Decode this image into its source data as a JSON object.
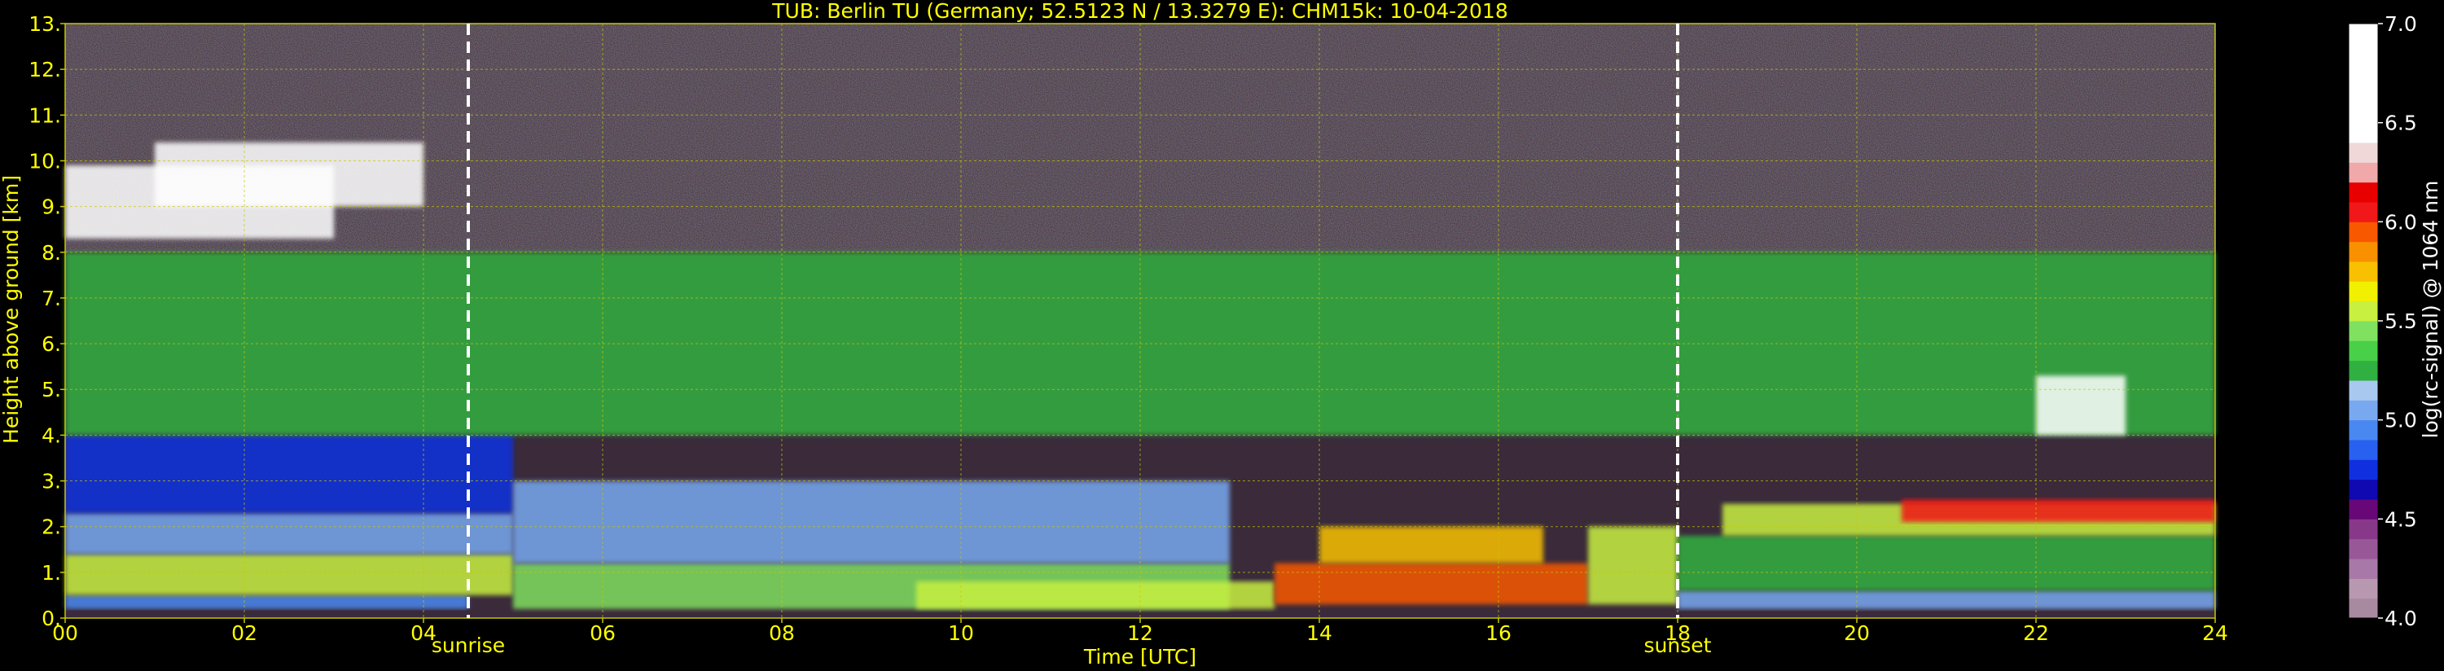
{
  "chart_data": {
    "type": "heatmap",
    "title": "TUB: Berlin TU (Germany; 52.5123 N / 13.3279 E):    CHM15k: 10-04-2018",
    "xlabel": "Time [UTC]",
    "ylabel": "Height above ground [km]",
    "xlim": [
      0,
      24
    ],
    "ylim": [
      0,
      13
    ],
    "x_ticks": [
      0,
      2,
      4,
      6,
      8,
      10,
      12,
      14,
      16,
      18,
      20,
      22,
      24
    ],
    "x_tick_labels": [
      "00",
      "02",
      "04",
      "06",
      "08",
      "10",
      "12",
      "14",
      "16",
      "18",
      "20",
      "22",
      "24"
    ],
    "y_ticks": [
      0,
      1,
      2,
      3,
      4,
      5,
      6,
      7,
      8,
      9,
      10,
      11,
      12,
      13
    ],
    "y_tick_labels": [
      "0.",
      "1.",
      "2.",
      "3.",
      "4.",
      "5.",
      "6.",
      "7.",
      "8.",
      "9.",
      "10.",
      "11.",
      "12.",
      "13."
    ],
    "grid": true,
    "annotations": [
      {
        "text": "sunrise",
        "x": 4.5
      },
      {
        "text": "sunset",
        "x": 18.0
      }
    ],
    "colorbar": {
      "label": "log(rc-signal) @ 1064 nm",
      "range": [
        4.0,
        7.0
      ],
      "ticks": [
        4.0,
        4.5,
        5.0,
        5.5,
        6.0,
        6.5,
        7.0
      ],
      "tick_labels": [
        "4.0",
        "4.5",
        "5.0",
        "5.5",
        "6.0",
        "6.5",
        "7.0"
      ],
      "colors": [
        "#a88aa0",
        "#b898b0",
        "#a878a8",
        "#985898",
        "#883888",
        "#680878",
        "#1008b0",
        "#1030e0",
        "#2860f0",
        "#4888f0",
        "#78a8f0",
        "#a8c8f0",
        "#30b040",
        "#48d048",
        "#80e060",
        "#c8f040",
        "#f0f000",
        "#f8c000",
        "#f89000",
        "#f85800",
        "#f01818",
        "#e80000",
        "#f0a8a8",
        "#f0d8d8",
        "#ffffff",
        "#ffffff",
        "#ffffff",
        "#ffffff",
        "#ffffff",
        "#ffffff"
      ]
    },
    "layers": [
      {
        "t0": 0,
        "t1": 4.5,
        "z0": 0.2,
        "z1": 0.5,
        "value": 4.9
      },
      {
        "t0": 0,
        "t1": 5,
        "z0": 0.5,
        "z1": 1.4,
        "value": 5.5
      },
      {
        "t0": 0,
        "t1": 5,
        "z0": 1.4,
        "z1": 2.3,
        "value": 5.1
      },
      {
        "t0": 0,
        "t1": 5,
        "z0": 2.3,
        "z1": 4.0,
        "value": 4.8
      },
      {
        "t0": 0,
        "t1": 24,
        "z0": 4.0,
        "z1": 8.0,
        "value": 5.2
      },
      {
        "t0": 0,
        "t1": 3.0,
        "z0": 8.3,
        "z1": 9.9,
        "value": 6.6
      },
      {
        "t0": 1.0,
        "t1": 4.0,
        "z0": 9.0,
        "z1": 10.4,
        "value": 6.8
      },
      {
        "t0": 5,
        "t1": 13,
        "z0": 0.2,
        "z1": 1.2,
        "value": 5.4
      },
      {
        "t0": 5,
        "t1": 13,
        "z0": 1.2,
        "z1": 3.0,
        "value": 5.1
      },
      {
        "t0": 9.5,
        "t1": 13.5,
        "z0": 0.2,
        "z1": 0.8,
        "value": 5.6
      },
      {
        "t0": 13.5,
        "t1": 17,
        "z0": 0.3,
        "z1": 1.2,
        "value": 5.9
      },
      {
        "t0": 14,
        "t1": 16.5,
        "z0": 1.2,
        "z1": 2.0,
        "value": 5.7
      },
      {
        "t0": 17,
        "t1": 18,
        "z0": 0.3,
        "z1": 2.0,
        "value": 5.5
      },
      {
        "t0": 18,
        "t1": 24,
        "z0": 0.2,
        "z1": 0.6,
        "value": 5.0
      },
      {
        "t0": 18,
        "t1": 24,
        "z0": 0.6,
        "z1": 1.8,
        "value": 5.2
      },
      {
        "t0": 18.5,
        "t1": 24,
        "z0": 1.8,
        "z1": 2.5,
        "value": 5.5
      },
      {
        "t0": 20.5,
        "t1": 24,
        "z0": 2.1,
        "z1": 2.6,
        "value": 6.1
      },
      {
        "t0": 22,
        "t1": 23,
        "z0": 4.0,
        "z1": 5.3,
        "value": 6.5
      }
    ]
  }
}
